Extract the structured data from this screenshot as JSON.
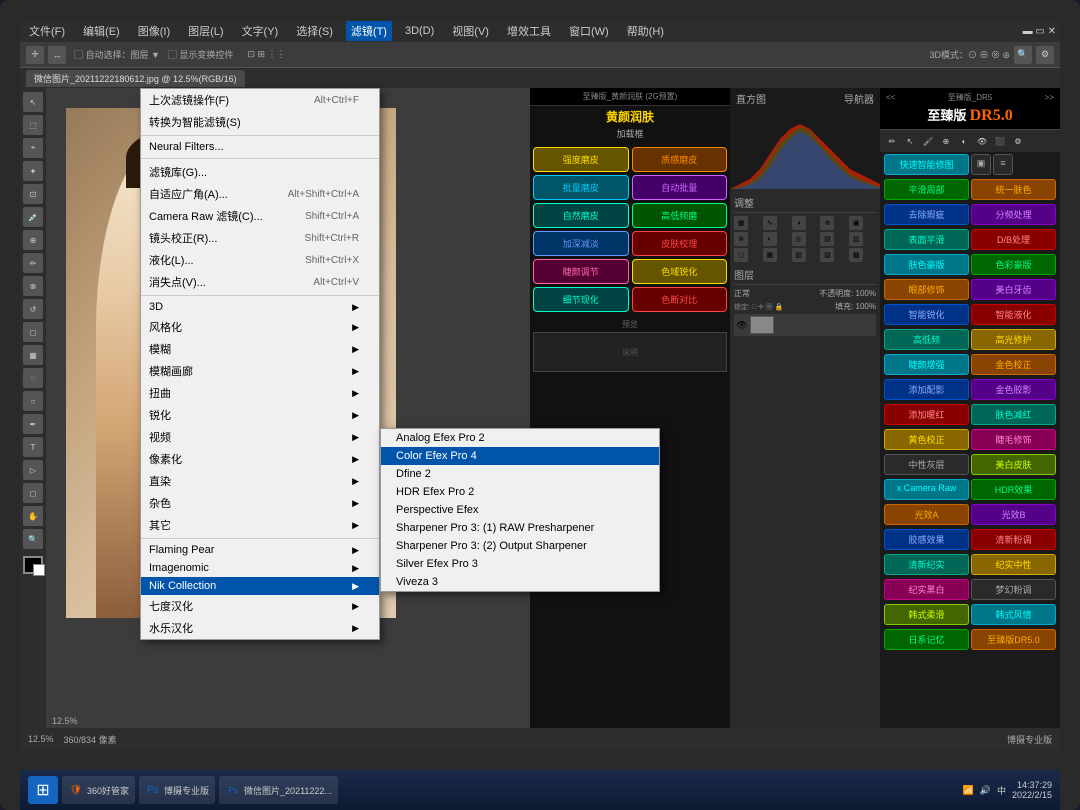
{
  "screen": {
    "title": "Photoshop with DR5 Plugin",
    "bg_color": "#3c3c3c"
  },
  "menu_bar": {
    "items": [
      "文件(F)",
      "编辑(E)",
      "图像(I)",
      "图层(L)",
      "文字(Y)",
      "选择(S)",
      "滤镜(T)",
      "3D(D)",
      "视图(V)",
      "增效工具",
      "窗口(W)",
      "帮助(H)"
    ]
  },
  "file_tab": {
    "label": "微信图片_20211222180612.jpg @ 12.5%(RGB/16)"
  },
  "dropdown": {
    "title": "滤镜菜单",
    "items": [
      {
        "label": "上次滤镜操作(F)",
        "shortcut": "Alt+Ctrl+F",
        "has_separator_before": false
      },
      {
        "label": "转换为智能滤镜(S)",
        "shortcut": "",
        "has_separator_before": false
      },
      {
        "label": "Neural Filters...",
        "shortcut": "",
        "has_separator_before": true
      },
      {
        "label": "滤镜库(G)...",
        "shortcut": "",
        "has_separator_before": true
      },
      {
        "label": "自适应广角(A)...",
        "shortcut": "Alt+Shift+Ctrl+A",
        "has_separator_before": false
      },
      {
        "label": "Camera Raw 滤镜(C)...",
        "shortcut": "Shift+Ctrl+A",
        "has_separator_before": false
      },
      {
        "label": "镜头校正(R)...",
        "shortcut": "Shift+Ctrl+R",
        "has_separator_before": false
      },
      {
        "label": "液化(L)...",
        "shortcut": "Shift+Ctrl+X",
        "has_separator_before": false
      },
      {
        "label": "消失点(V)...",
        "shortcut": "Alt+Ctrl+V",
        "has_separator_before": false
      },
      {
        "label": "3D",
        "shortcut": "",
        "has_arrow": true,
        "has_separator_before": true
      },
      {
        "label": "风格化",
        "shortcut": "",
        "has_arrow": true
      },
      {
        "label": "模糊",
        "shortcut": "",
        "has_arrow": true
      },
      {
        "label": "模糊画廊",
        "shortcut": "",
        "has_arrow": true
      },
      {
        "label": "扭曲",
        "shortcut": "",
        "has_arrow": true
      },
      {
        "label": "锐化",
        "shortcut": "",
        "has_arrow": true
      },
      {
        "label": "视频",
        "shortcut": "",
        "has_arrow": true
      },
      {
        "label": "像素化",
        "shortcut": "",
        "has_arrow": true
      },
      {
        "label": "直染",
        "shortcut": "",
        "has_arrow": true
      },
      {
        "label": "杂色",
        "shortcut": "",
        "has_arrow": true
      },
      {
        "label": "其它",
        "shortcut": "",
        "has_arrow": true
      },
      {
        "label": "Flaming Pear",
        "shortcut": "",
        "has_arrow": true,
        "has_separator_before": true
      },
      {
        "label": "Imagenomic",
        "shortcut": "",
        "has_arrow": true
      },
      {
        "label": "Nik Collection",
        "shortcut": "",
        "has_arrow": true,
        "highlighted": true
      },
      {
        "label": "七度汉化",
        "shortcut": "",
        "has_arrow": true
      },
      {
        "label": "水乐汉化",
        "shortcut": "",
        "has_arrow": true
      }
    ],
    "submenu": {
      "items": [
        {
          "label": "Analog Efex Pro 2"
        },
        {
          "label": "Color Efex Pro 4",
          "highlighted": true
        },
        {
          "label": "Dfine 2"
        },
        {
          "label": "HDR Efex Pro 2"
        },
        {
          "label": "Perspective Efex"
        },
        {
          "label": "Sharpener Pro 3: (1) RAW Presharpener"
        },
        {
          "label": "Sharpener Pro 3: (2) Output Sharpener"
        },
        {
          "label": "Silver Efex Pro 3"
        },
        {
          "label": "Viveza 3"
        }
      ]
    }
  },
  "dr5_panel": {
    "title": "至臻版",
    "version": "DR5.0",
    "section_title": "黄颜润肤",
    "section_subtitle": "加载框",
    "buttons": [
      {
        "label": "强度磨皮",
        "class": "btn-cyan"
      },
      {
        "label": "质感磨皮",
        "class": "btn-green"
      },
      {
        "label": "批量磨皮",
        "class": "btn-orange"
      },
      {
        "label": "自动批量",
        "class": "btn-purple"
      },
      {
        "label": "自然磨皮",
        "class": "btn-blue"
      },
      {
        "label": "高低频磨",
        "class": "btn-red"
      },
      {
        "label": "加深减淡",
        "class": "btn-teal"
      },
      {
        "label": "皮肤校理",
        "class": "btn-yellow"
      },
      {
        "label": "睫颜调节",
        "class": "btn-pink"
      },
      {
        "label": "色域锐化",
        "class": "btn-dark"
      },
      {
        "label": "细节现化",
        "class": "btn-lime"
      },
      {
        "label": "色断对比",
        "class": "btn-red"
      }
    ],
    "right_buttons": [
      {
        "label": "快速智能修图",
        "class": "btn-cyan"
      },
      {
        "label": "平滑周部",
        "class": "btn-green"
      },
      {
        "label": "统一肤色",
        "class": "btn-orange"
      },
      {
        "label": "去除瑕疵",
        "class": "btn-blue"
      },
      {
        "label": "分频处理",
        "class": "btn-purple"
      },
      {
        "label": "表面平滑",
        "class": "btn-teal"
      },
      {
        "label": "D/B处理",
        "class": "btn-red"
      },
      {
        "label": "肤色豪版",
        "class": "btn-cyan"
      },
      {
        "label": "色彩豪版",
        "class": "btn-green"
      },
      {
        "label": "眼部修饰",
        "class": "btn-orange"
      },
      {
        "label": "美白牙齿",
        "class": "btn-purple"
      },
      {
        "label": "智能锐化",
        "class": "btn-blue"
      },
      {
        "label": "智能液化",
        "class": "btn-red"
      },
      {
        "label": "高低频",
        "class": "btn-teal"
      },
      {
        "label": "高光修护",
        "class": "btn-yellow"
      },
      {
        "label": "睫颜增强",
        "class": "btn-cyan"
      },
      {
        "label": "金色校正",
        "class": "btn-orange"
      },
      {
        "label": "添加配影",
        "class": "btn-blue"
      },
      {
        "label": "金色胶影",
        "class": "btn-purple"
      },
      {
        "label": "添加暖红",
        "class": "btn-red"
      },
      {
        "label": "肤色减红",
        "class": "btn-teal"
      },
      {
        "label": "黄色校正",
        "class": "btn-yellow"
      },
      {
        "label": "睫毛修饰",
        "class": "btn-pink"
      },
      {
        "label": "中性灰层",
        "class": "btn-dark"
      },
      {
        "label": "美白皮肤",
        "class": "btn-lime"
      },
      {
        "label": "x Camera Raw",
        "class": "btn-cyan"
      },
      {
        "label": "HDR效果",
        "class": "btn-green"
      },
      {
        "label": "光效A",
        "class": "btn-orange"
      },
      {
        "label": "光效B",
        "class": "btn-purple"
      },
      {
        "label": "胶感效果",
        "class": "btn-blue"
      },
      {
        "label": "清新粉调",
        "class": "btn-red"
      },
      {
        "label": "清新纪实",
        "class": "btn-teal"
      },
      {
        "label": "纪实中性",
        "class": "btn-yellow"
      },
      {
        "label": "纪实黑白",
        "class": "btn-pink"
      },
      {
        "label": "梦幻粉调",
        "class": "btn-dark"
      },
      {
        "label": "韩式柔滑",
        "class": "btn-lime"
      },
      {
        "label": "韩式风情",
        "class": "btn-cyan"
      },
      {
        "label": "日系记忆",
        "class": "btn-green"
      },
      {
        "label": "至臻版DR5.0",
        "class": "btn-orange"
      }
    ]
  },
  "histogram": {
    "title": "直方图",
    "nav_title": "导航器"
  },
  "status_bar": {
    "zoom": "12.5%",
    "info": "360/834 像素",
    "file_info": "博摄专业版"
  },
  "taskbar": {
    "start_icon": "⊞",
    "items": [
      {
        "label": "360好管家",
        "icon_color": "#ff6600"
      },
      {
        "label": "博摄专业版",
        "icon_color": "#cc0000"
      },
      {
        "label": "微信图片_20211222...",
        "icon_color": "#0066cc"
      }
    ],
    "clock": "14:37:29",
    "date": "2022/2/15",
    "system_icons": [
      "🔔",
      "📶",
      "🔊",
      "中"
    ]
  }
}
